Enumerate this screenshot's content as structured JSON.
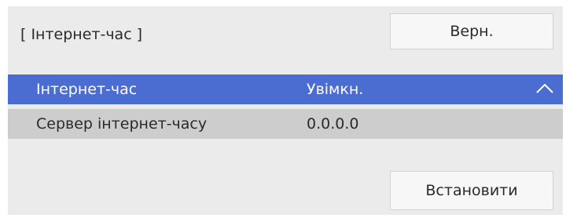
{
  "header": {
    "title": "[ Інтернет-час ]",
    "back_label": "Верн."
  },
  "settings": {
    "rows": [
      {
        "label": "Інтернет-час",
        "value": "Увімкн."
      },
      {
        "label": "Сервер інтернет-часу",
        "value": "0.0.0.0"
      }
    ]
  },
  "footer": {
    "set_label": "Встановити"
  },
  "colors": {
    "panel_bg": "#ebebeb",
    "selected_row": "#4b6cd0",
    "secondary_row": "#cdcdcd",
    "button_bg": "#f7f7f7"
  },
  "icons": {
    "expand": "chevron-up-icon"
  }
}
